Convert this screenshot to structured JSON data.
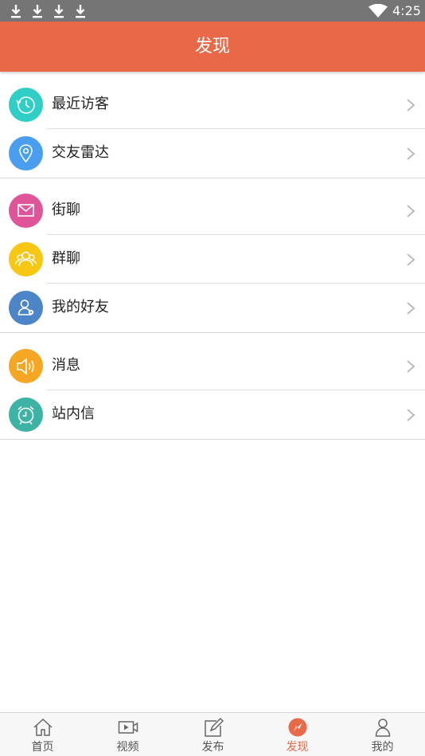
{
  "status_bar": {
    "time": "4:25",
    "icons": [
      "download-icon",
      "download-icon",
      "download-icon",
      "download-icon",
      "wifi-icon"
    ]
  },
  "header": {
    "title": "发现"
  },
  "menu": {
    "groups": [
      {
        "items": [
          {
            "label": "最近访客",
            "icon": "recent-visitors-icon",
            "color": "#2fcfc7"
          },
          {
            "label": "交友雷达",
            "icon": "location-pin-icon",
            "color": "#4a9ef0"
          }
        ]
      },
      {
        "items": [
          {
            "label": "街聊",
            "icon": "mail-icon",
            "color": "#e0559a"
          },
          {
            "label": "群聊",
            "icon": "group-users-icon",
            "color": "#f7c713"
          },
          {
            "label": "我的好友",
            "icon": "friend-icon",
            "color": "#4d86c8"
          }
        ]
      },
      {
        "items": [
          {
            "label": "消息",
            "icon": "speaker-icon",
            "color": "#f5a623"
          },
          {
            "label": "站内信",
            "icon": "alarm-clock-icon",
            "color": "#3cb3a4"
          }
        ]
      }
    ]
  },
  "bottom_nav": {
    "items": [
      {
        "label": "首页",
        "icon": "home-icon",
        "active": false
      },
      {
        "label": "视频",
        "icon": "video-icon",
        "active": false
      },
      {
        "label": "发布",
        "icon": "edit-icon",
        "active": false
      },
      {
        "label": "发现",
        "icon": "compass-icon",
        "active": true
      },
      {
        "label": "我的",
        "icon": "user-icon",
        "active": false
      }
    ],
    "active_color": "#e86848",
    "inactive_color": "#555555"
  }
}
